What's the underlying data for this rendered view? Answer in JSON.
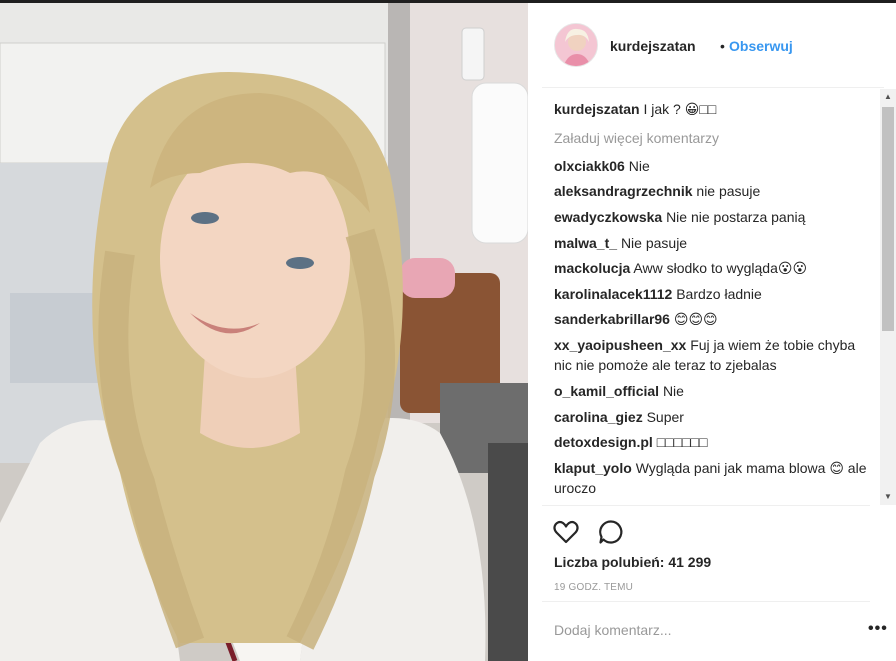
{
  "header": {
    "username": "kurdejszatan",
    "separator": "•",
    "follow_label": "Obserwuj"
  },
  "caption": {
    "user": "kurdejszatan",
    "text": "I jak ? 😀□□"
  },
  "load_more_label": "Załaduj więcej komentarzy",
  "comments": [
    {
      "user": "olxciakk06",
      "text": "Nie"
    },
    {
      "user": "aleksandragrzechnik",
      "text": "nie pasuje"
    },
    {
      "user": "ewadyczkowska",
      "text": "Nie nie postarza panią"
    },
    {
      "user": "malwa_t_",
      "text": "Nie pasuje"
    },
    {
      "user": "mackolucja",
      "text": "Aww słodko to wygląda😮😮"
    },
    {
      "user": "karolinalacek1112",
      "text": "Bardzo ładnie"
    },
    {
      "user": "sanderkabrillar96",
      "text": "😊😊😊"
    },
    {
      "user": "xx_yaoipusheen_xx",
      "text": "Fuj ja wiem że tobie chyba nic nie pomoże ale teraz to zjebalas"
    },
    {
      "user": "o_kamil_official",
      "text": "Nie"
    },
    {
      "user": "carolina_giez",
      "text": "Super"
    },
    {
      "user": "detoxdesign.pl",
      "text": "□□□□□□"
    },
    {
      "user": "klaput_yolo",
      "text": "Wygląda pani jak mama blowa 😊 ale uroczo"
    }
  ],
  "likes_text": "Liczba polubień: 41 299",
  "time_text": "19 GODZ. TEMU",
  "add_comment": {
    "placeholder": "Dodaj komentarz..."
  },
  "more_label": "•••",
  "scroll": {
    "up": "▲",
    "down": "▼"
  },
  "icons": {
    "like": "heart-icon",
    "comment": "comment-bubble-icon",
    "more": "more-options-icon"
  },
  "colors": {
    "link_blue": "#3897f0",
    "muted_gray": "#999999",
    "divider": "#efefef"
  }
}
